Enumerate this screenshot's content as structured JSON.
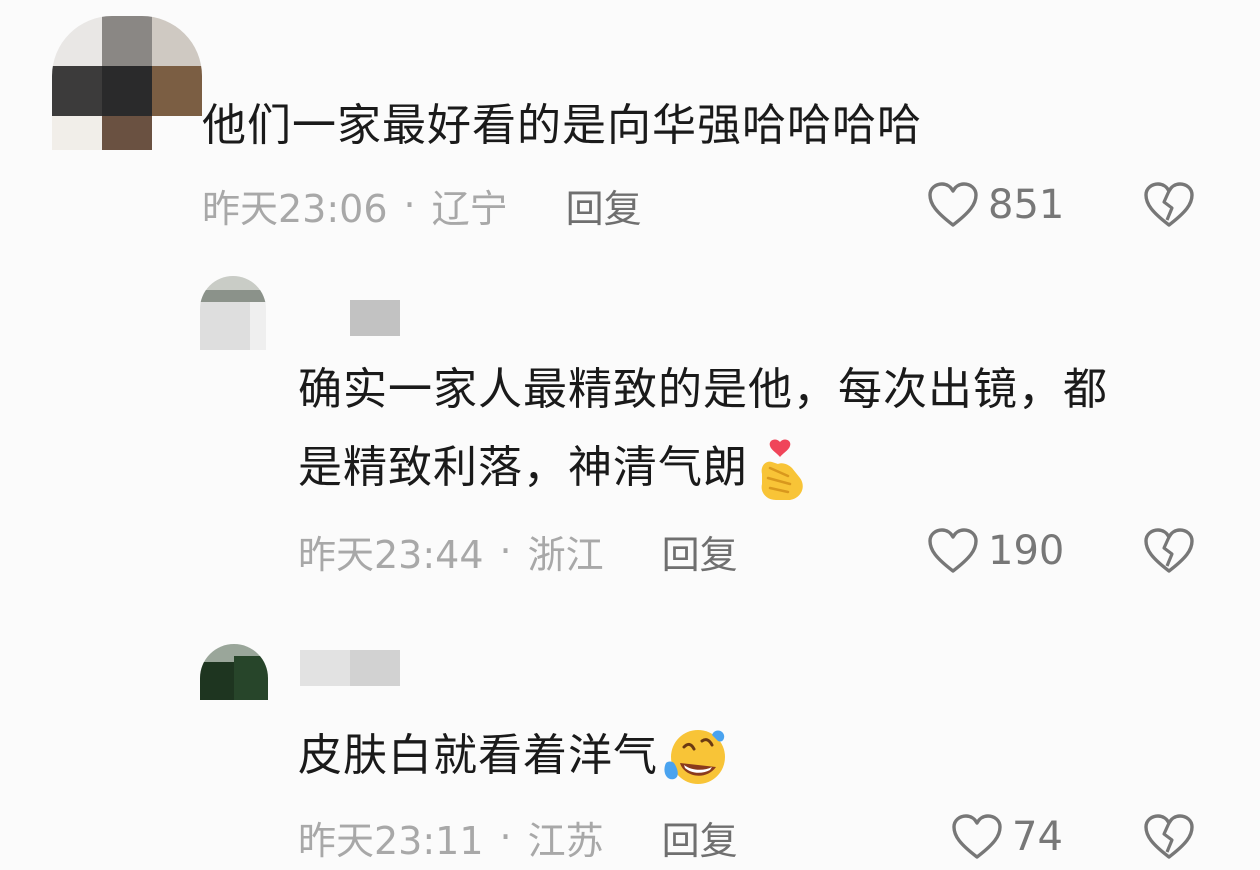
{
  "comments": [
    {
      "text": "他们一家最好看的是向华强哈哈哈哈",
      "time": "昨天23:06",
      "location": "辽宁",
      "reply": "回复",
      "likes": "851"
    },
    {
      "text_line1": "确实一家人最精致的是他，每次出镜，都",
      "text_line2": "是精致利落，神清气朗",
      "emoji": "finger-heart-emoji",
      "time": "昨天23:44",
      "location": "浙江",
      "reply": "回复",
      "likes": "190"
    },
    {
      "text": "皮肤白就看着洋气",
      "emoji": "rolling-laughing-emoji",
      "time": "昨天23:11",
      "location": "江苏",
      "reply": "回复",
      "likes": "74"
    }
  ],
  "separator": "·",
  "icons": {
    "like": "heart-outline-icon",
    "dislike": "broken-heart-icon"
  }
}
